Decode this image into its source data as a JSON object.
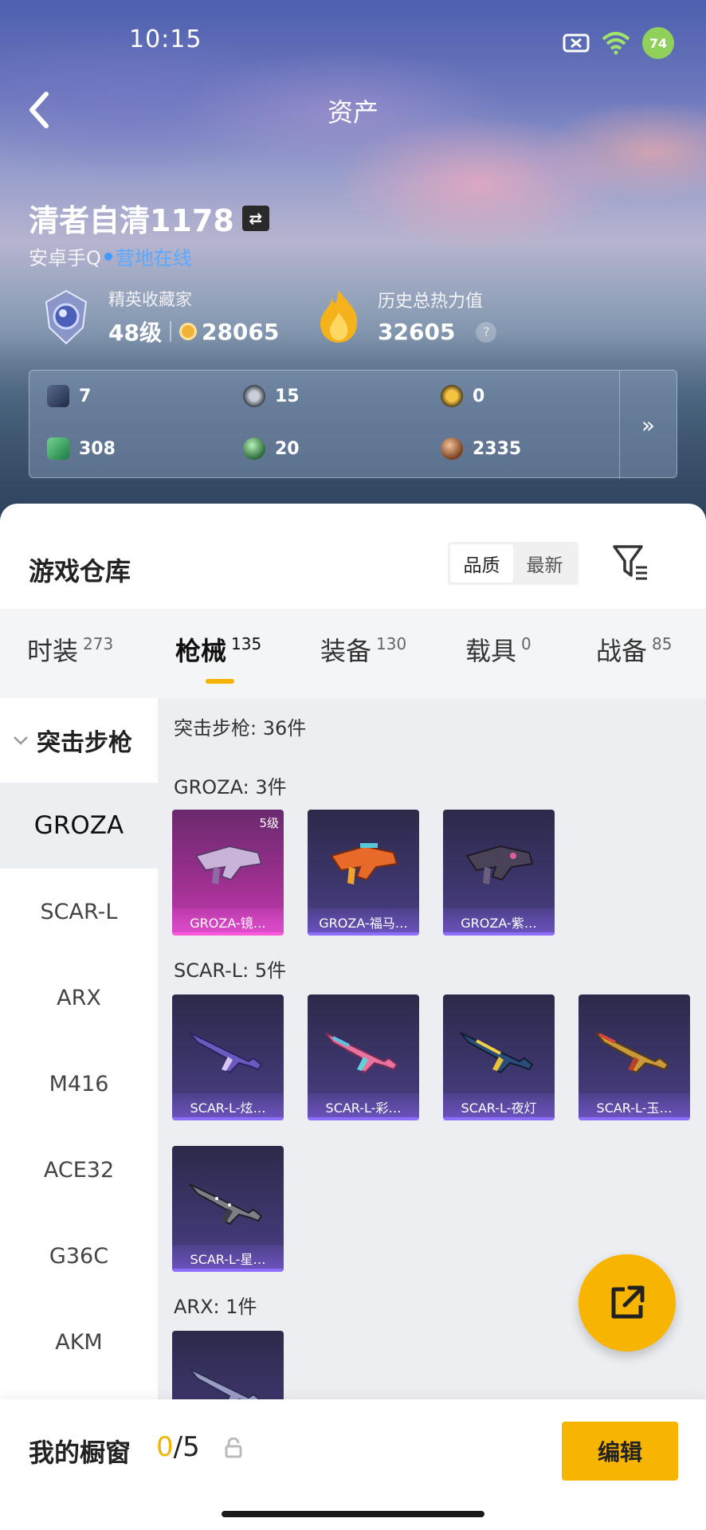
{
  "status_bar": {
    "time": "10:15",
    "battery": "74"
  },
  "header": {
    "title": "资产"
  },
  "profile": {
    "username": "清者自清1178",
    "swap_icon": "⇄",
    "platform": "安卓手Q",
    "online_status": "营地在线",
    "rank_title": "精英收藏家",
    "level": "48级",
    "collection_points": "28065",
    "heat_title": "历史总热力值",
    "heat_value": "32605",
    "help_icon": "?"
  },
  "stats": {
    "items": [
      {
        "icon": "card-icon",
        "value": "7"
      },
      {
        "icon": "coin-gray-icon",
        "value": "15"
      },
      {
        "icon": "coin-gold-icon",
        "value": "0"
      },
      {
        "icon": "green-card-icon",
        "value": "308"
      },
      {
        "icon": "green-orb-icon",
        "value": "20"
      },
      {
        "icon": "bronze-orb-icon",
        "value": "2335"
      }
    ],
    "more": "»"
  },
  "repo": {
    "title": "游戏仓库",
    "sort_options": [
      "品质",
      "最新"
    ],
    "active_sort": "品质"
  },
  "categories": [
    {
      "label": "时装",
      "count": "273"
    },
    {
      "label": "枪械",
      "count": "135",
      "active": true
    },
    {
      "label": "装备",
      "count": "130"
    },
    {
      "label": "载具",
      "count": "0"
    },
    {
      "label": "战备",
      "count": "85"
    }
  ],
  "sidebar": {
    "group": "突击步枪",
    "items": [
      "GROZA",
      "SCAR-L",
      "ARX",
      "M416",
      "ACE32",
      "G36C",
      "AKM"
    ],
    "active": "GROZA"
  },
  "list": {
    "summary": "突击步枪: 36件",
    "groups": [
      {
        "title": "GROZA: 3件",
        "items": [
          {
            "name": "GROZA-镜…",
            "level": "5级",
            "rarity": "pink"
          },
          {
            "name": "GROZA-福马…",
            "rarity": "purple"
          },
          {
            "name": "GROZA-紫…",
            "rarity": "purple"
          }
        ]
      },
      {
        "title": "SCAR-L: 5件",
        "items": [
          {
            "name": "SCAR-L-炫…"
          },
          {
            "name": "SCAR-L-彩…"
          },
          {
            "name": "SCAR-L-夜灯"
          },
          {
            "name": "SCAR-L-玉…"
          },
          {
            "name": "SCAR-L-星…"
          }
        ]
      },
      {
        "title": "ARX: 1件",
        "items": [
          {
            "name": ""
          }
        ]
      }
    ]
  },
  "footer": {
    "label": "我的橱窗",
    "current": "0",
    "total": "/5",
    "edit_label": "编辑"
  },
  "colors": {
    "accent": "#f7b400",
    "online": "#3f9bff",
    "card_purple": "#4b3f86",
    "card_pink": "#c23bb0"
  }
}
